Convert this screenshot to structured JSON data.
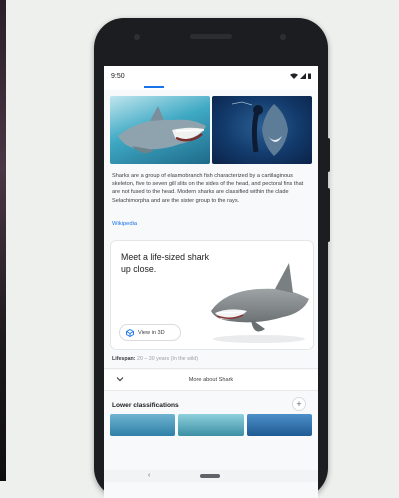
{
  "status": {
    "time": "9:50",
    "icons": [
      "wifi-icon",
      "signal-icon",
      "battery-icon"
    ]
  },
  "images": [
    {
      "name": "shark-photo-1",
      "icon": "shark-image"
    },
    {
      "name": "shark-photo-2",
      "icon": "shark-image"
    }
  ],
  "description": "Sharks are a group of elasmobranch fish characterized by a cartilaginous skeleton, five to seven gill slits on the sides of the head, and pectoral fins that are not fused to the head. Modern sharks are classified within the clade Selachimorpha and are the sister group to the rays.",
  "source_link": "Wikipedia",
  "card3d": {
    "title": "Meet a life-sized shark up close.",
    "button_label": "View in 3D",
    "button_icon": "ar-cube-icon"
  },
  "lifespan": {
    "label": "Lifespan:",
    "value": "20 – 30 years (In the wild)"
  },
  "more": {
    "label": "More about Shark",
    "icon": "chevron-down-icon"
  },
  "lower": {
    "title": "Lower classifications",
    "add_icon": "plus-icon"
  },
  "colors": {
    "accent": "#1a73e8",
    "phone_body": "#1c1d20"
  }
}
